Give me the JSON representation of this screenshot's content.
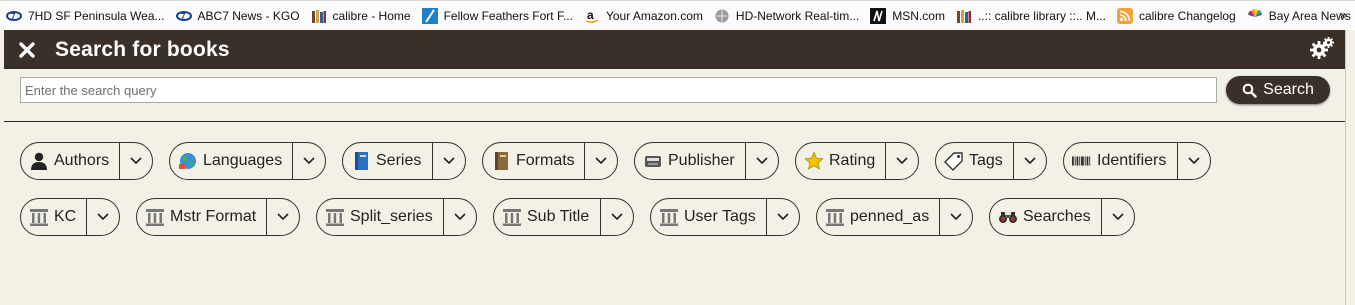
{
  "bookmarks": [
    {
      "label": "7HD SF Peninsula Wea...",
      "icon": "weather-icon"
    },
    {
      "label": "ABC7 News - KGO",
      "icon": "abc7-icon"
    },
    {
      "label": "calibre - Home",
      "icon": "books-icon"
    },
    {
      "label": "Fellow Feathers Fort F...",
      "icon": "feather-icon"
    },
    {
      "label": "Your Amazon.com",
      "icon": "amazon-icon"
    },
    {
      "label": "HD-Network Real-tim...",
      "icon": "globe-icon"
    },
    {
      "label": "MSN.com",
      "icon": "msn-icon"
    },
    {
      "label": "..:: calibre library ::.. M...",
      "icon": "books-icon"
    },
    {
      "label": "calibre Changelog",
      "icon": "rss-icon"
    },
    {
      "label": "Bay Area News !!",
      "icon": "nbc-icon"
    }
  ],
  "bookmarks_more": "»",
  "header": {
    "title": "Search for books"
  },
  "search": {
    "placeholder": "Enter the search query",
    "value": "",
    "button_label": "Search"
  },
  "categories": [
    {
      "label": "Authors",
      "icon": "person-icon"
    },
    {
      "label": "Languages",
      "icon": "languages-icon"
    },
    {
      "label": "Series",
      "icon": "series-book-icon"
    },
    {
      "label": "Formats",
      "icon": "formats-book-icon"
    },
    {
      "label": "Publisher",
      "icon": "publisher-icon"
    },
    {
      "label": "Rating",
      "icon": "star-icon"
    },
    {
      "label": "Tags",
      "icon": "tag-icon"
    },
    {
      "label": "Identifiers",
      "icon": "barcode-icon"
    },
    {
      "label": "KC",
      "icon": "column-icon"
    },
    {
      "label": "Mstr Format",
      "icon": "column-icon"
    },
    {
      "label": "Split_series",
      "icon": "column-icon"
    },
    {
      "label": "Sub Title",
      "icon": "column-icon"
    },
    {
      "label": "User Tags",
      "icon": "column-icon"
    },
    {
      "label": "penned_as",
      "icon": "column-icon"
    },
    {
      "label": "Searches",
      "icon": "binoculars-icon"
    }
  ],
  "colors": {
    "header_bg": "#3a302a",
    "panel_bg": "#f3f1e6",
    "accent_star": "#f2c200"
  }
}
